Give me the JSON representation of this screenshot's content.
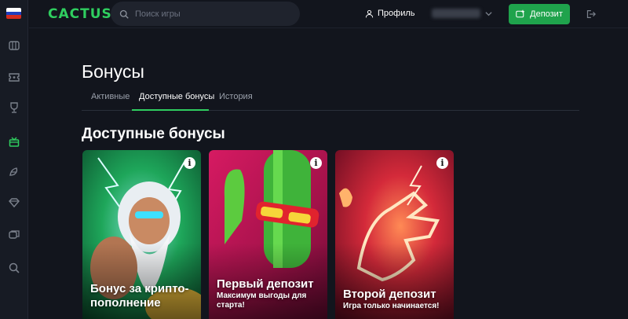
{
  "header": {
    "logo": "CACTUS",
    "search_placeholder": "Поиск игры",
    "profile_label": "Профиль",
    "deposit_label": "Депозит"
  },
  "sidebar": {
    "icons": [
      "flag-ru-icon",
      "slots-icon",
      "ticket-icon",
      "trophy-icon",
      "gift-icon",
      "live-casino-icon",
      "diamond-icon",
      "chat-icon",
      "search-icon"
    ]
  },
  "page": {
    "title": "Бонусы",
    "tabs": [
      {
        "label": "Активные",
        "active": false
      },
      {
        "label": "Доступные бонусы",
        "active": true
      },
      {
        "label": "История",
        "active": false
      }
    ],
    "section_title": "Доступные бонусы"
  },
  "bonuses": [
    {
      "title": "Бонус за крипто-пополнение",
      "subtitle": "",
      "theme": "#1f9c3a",
      "info": "i"
    },
    {
      "title": "Первый депозит",
      "subtitle": "Максимум выгоды для старта!",
      "theme": "#b8174f",
      "info": "i"
    },
    {
      "title": "Второй депозит",
      "subtitle": "Игра только начинается!",
      "theme": "#c21f3a",
      "info": "i"
    }
  ],
  "colors": {
    "accent": "#2fce5f",
    "deposit_button": "#1fa34c",
    "background": "#12151d",
    "sidebar": "#171b24"
  }
}
